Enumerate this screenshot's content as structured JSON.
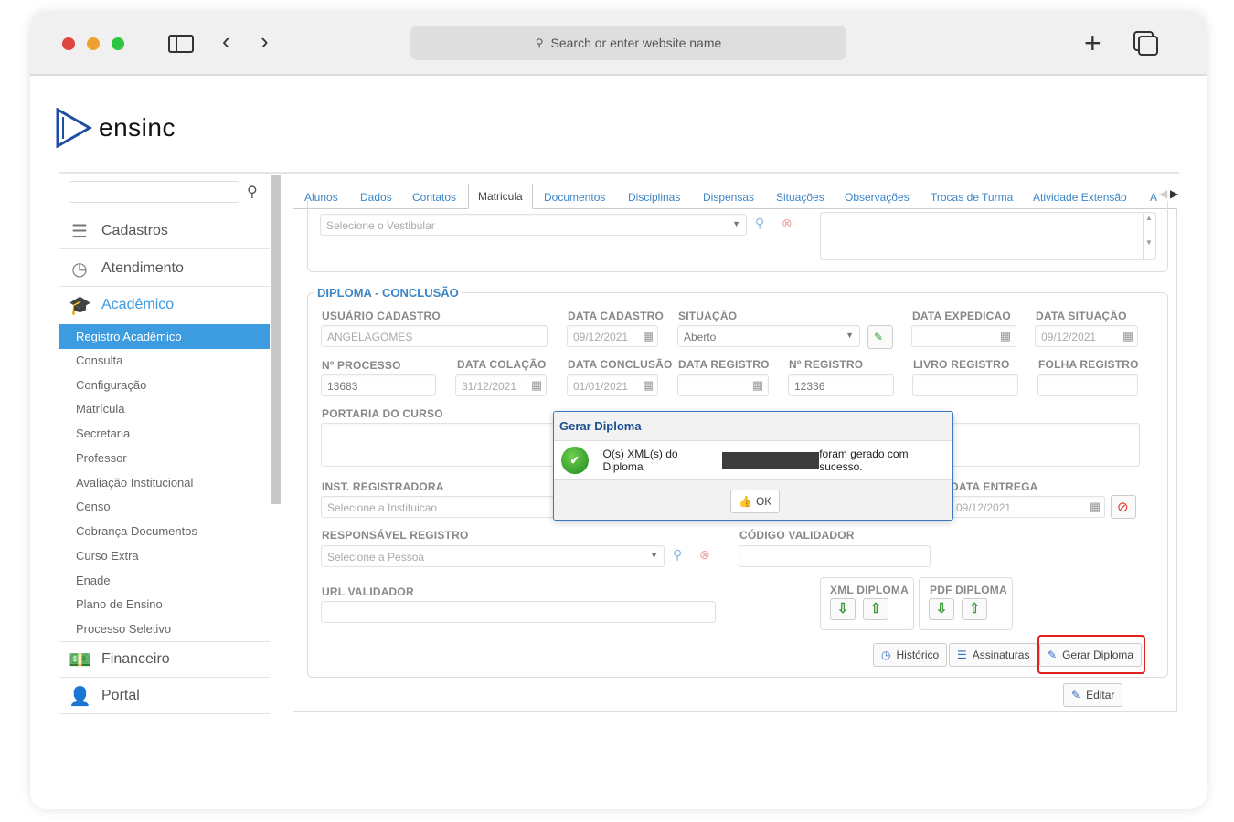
{
  "browser": {
    "url_placeholder": "Search or enter website name",
    "colors": {
      "close": "#e0443e",
      "min": "#f0a030",
      "max": "#2ec63f"
    }
  },
  "logo": {
    "text": "ensinc"
  },
  "sidebar": {
    "main_items": [
      {
        "label": "Cadastros",
        "icon": "list-icon"
      },
      {
        "label": "Atendimento",
        "icon": "clock-user-icon"
      },
      {
        "label": "Acadêmico",
        "icon": "graduation-cap-icon"
      },
      {
        "label": "Financeiro",
        "icon": "money-icon"
      },
      {
        "label": "Portal",
        "icon": "portal-user-icon"
      }
    ],
    "sub_items": [
      "Registro Acadêmico",
      "Consulta",
      "Configuração",
      "Matrícula",
      "Secretaria",
      "Professor",
      "Avaliação Institucional",
      "Censo",
      "Cobrança Documentos",
      "Curso Extra",
      "Enade",
      "Plano de Ensino",
      "Processo Seletivo"
    ],
    "active_sub": "Registro Acadêmico"
  },
  "tabs": [
    "Alunos",
    "Dados",
    "Contatos",
    "Matricula",
    "Documentos",
    "Disciplinas",
    "Dispensas",
    "Situações",
    "Observações",
    "Trocas de Turma",
    "Atividade Extensão",
    "A"
  ],
  "active_tab": "Matricula",
  "top": {
    "vestibular_placeholder": "Selecione o Vestibular"
  },
  "diploma": {
    "legend": "DIPLOMA - CONCLUSÃO",
    "usuario_label": "USUÁRIO CADASTRO",
    "usuario": "ANGELAGOMES",
    "data_cadastro_label": "DATA CADASTRO",
    "data_cadastro": "09/12/2021",
    "situacao_label": "SITUAÇÃO",
    "situacao": "Aberto",
    "data_expedicao_label": "DATA EXPEDICAO",
    "data_expedicao": "",
    "data_situacao_label": "DATA SITUAÇÃO",
    "data_situacao": "09/12/2021",
    "processo_label": "Nº PROCESSO",
    "processo": "13683",
    "colacao_label": "DATA COLAÇÃO",
    "colacao": "31/12/2021",
    "conclusao_label": "DATA CONCLUSÃO",
    "conclusao": "01/01/2021",
    "data_registro_label": "DATA REGISTRO",
    "data_registro": "",
    "registro_label": "Nº REGISTRO",
    "registro": "12336",
    "livro_label": "LIVRO REGISTRO",
    "folha_label": "FOLHA REGISTRO",
    "portaria_label": "PORTARIA DO CURSO",
    "inst_label": "INST. REGISTRADORA",
    "inst_placeholder": "Selecione a Instituicao",
    "entrega_label": "DATA ENTREGA",
    "entrega": "09/12/2021",
    "resp_label": "RESPONSÁVEL REGISTRO",
    "resp_placeholder": "Selecione a Pessoa",
    "codigo_label": "CÓDIGO VALIDADOR",
    "url_label": "URL VALIDADOR",
    "xml_label": "XML DIPLOMA",
    "pdf_label": "PDF DIPLOMA",
    "historico": "Histórico",
    "assinaturas": "Assinaturas",
    "gerar": "Gerar Diploma",
    "editar": "Editar"
  },
  "dialog": {
    "title": "Gerar Diploma",
    "msg_before": "O(s) XML(s) do Diploma",
    "msg_after": "foram gerado com sucesso.",
    "ok": "OK"
  }
}
